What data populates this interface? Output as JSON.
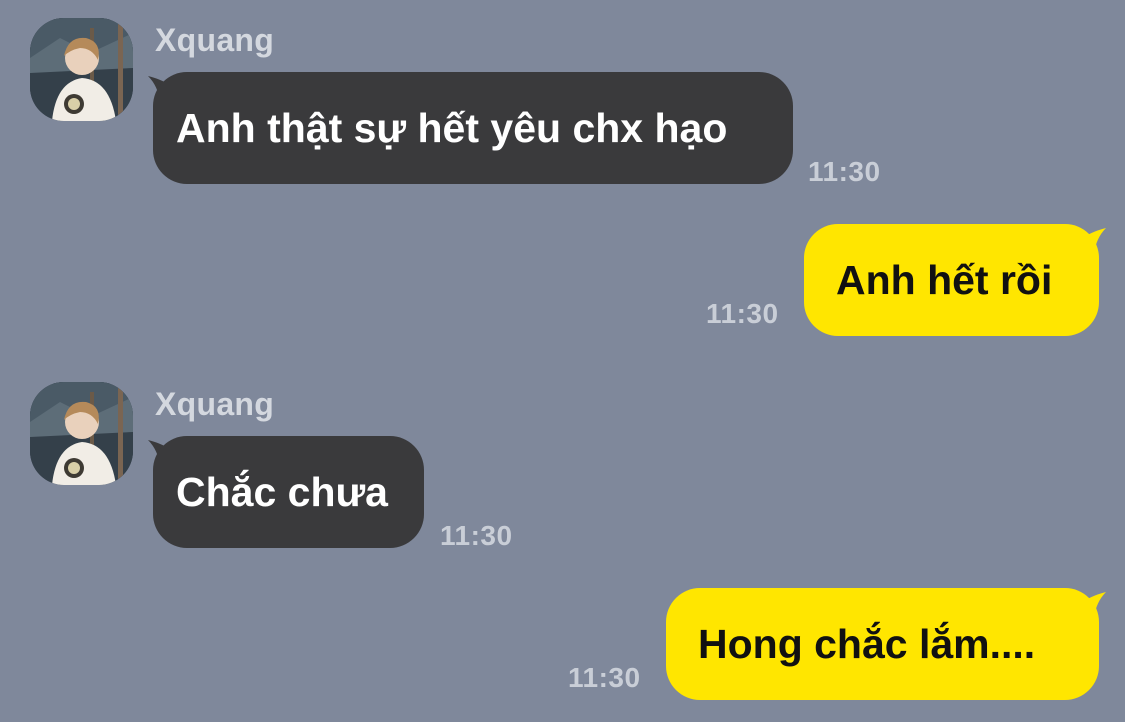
{
  "colors": {
    "background": "#7f889b",
    "incoming_bubble": "#3a3a3c",
    "outgoing_bubble": "#ffe600",
    "sender_name": "#d4d8df",
    "timestamp": "#c9ced7"
  },
  "messages": [
    {
      "direction": "incoming",
      "sender": "Xquang",
      "avatar": "user-avatar-photo",
      "text": "Anh thật sự hết yêu chx hạo",
      "time": "11:30"
    },
    {
      "direction": "outgoing",
      "text": "Anh hết rồi",
      "time": "11:30"
    },
    {
      "direction": "incoming",
      "sender": "Xquang",
      "avatar": "user-avatar-photo",
      "text": "Chắc chưa",
      "time": "11:30"
    },
    {
      "direction": "outgoing",
      "text": "Hong chắc lắm....",
      "time": "11:30"
    }
  ]
}
